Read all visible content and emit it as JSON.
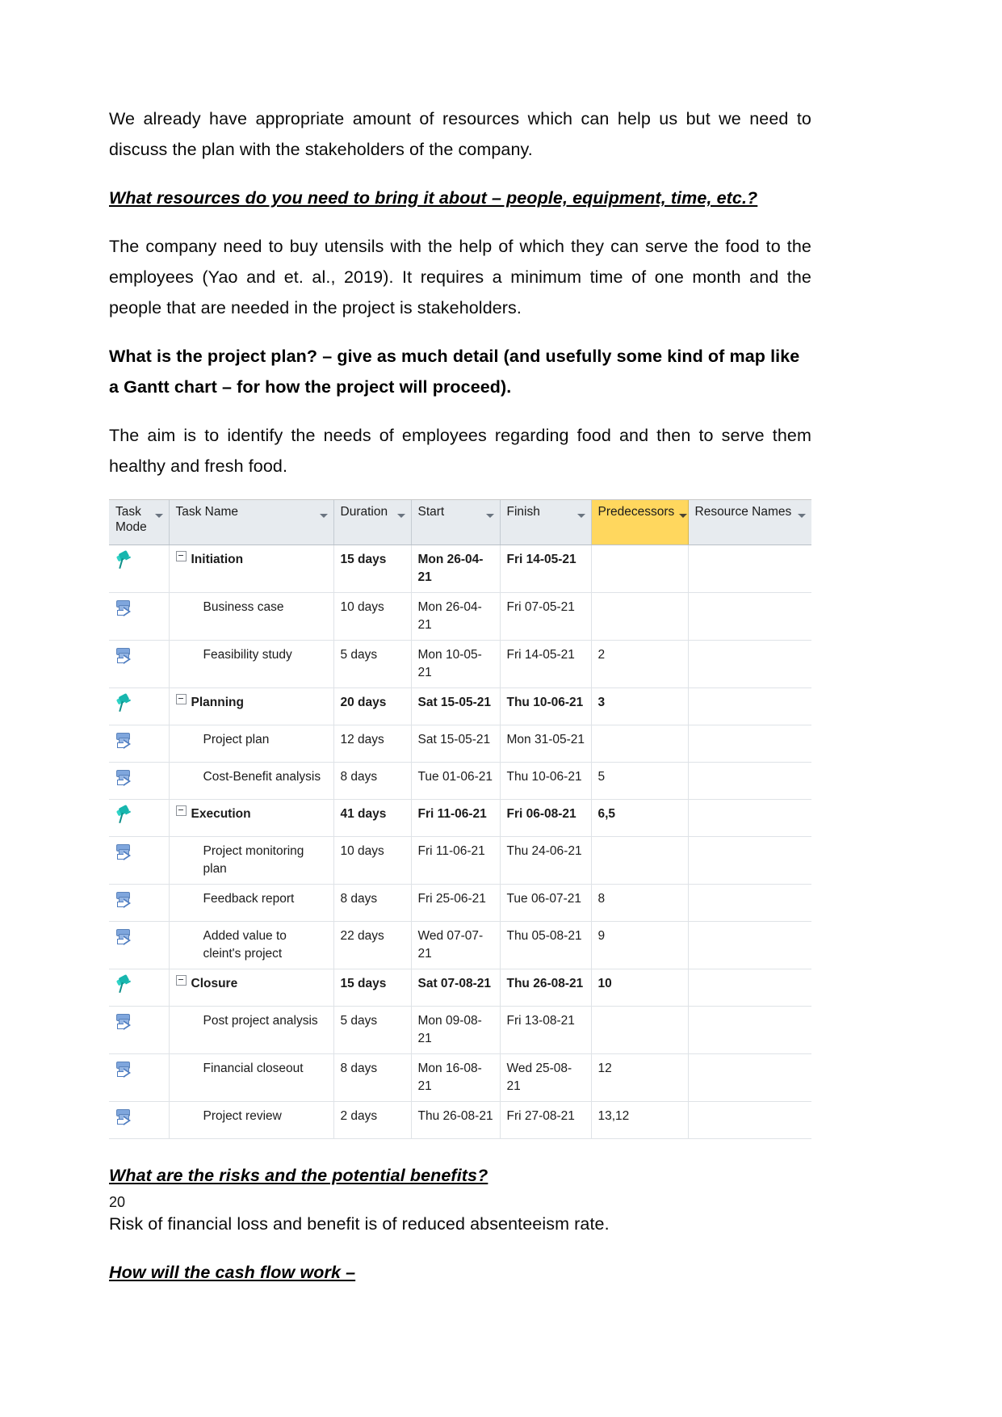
{
  "document": {
    "page_number": "20",
    "paragraphs": {
      "intro": "We already have appropriate amount of resources which can help us but we need to discuss the plan with the stakeholders of the company.",
      "resources_heading": "What resources do you need to bring it about – people, equipment, time, etc.?",
      "resources_answer": "The company need to buy utensils with the help of which they can serve the food to the employees (Yao and et. al., 2019). It requires a minimum time of one month and the people that are needed in the project is stakeholders.",
      "plan_heading": "What is the project plan? – give as much detail (and usefully some kind of map like a Gantt chart – for how the project will proceed).",
      "plan_answer": "The aim is to identify the needs of employees regarding food and then to serve them healthy and fresh food.",
      "risks_heading": "What are the risks and the potential benefits?",
      "risks_answer": "Risk of financial loss and benefit is of reduced absenteeism rate.",
      "cashflow_heading": "How will the cash flow work –"
    }
  },
  "project_table": {
    "highlight_color": "#ffd75e",
    "header_background": "#e7ebef",
    "columns": [
      {
        "label": "Task Mode",
        "key": "mode",
        "has_filter": true,
        "highlighted": false
      },
      {
        "label": "Task Name",
        "key": "name",
        "has_filter": true,
        "highlighted": false
      },
      {
        "label": "Duration",
        "key": "duration",
        "has_filter": true,
        "highlighted": false
      },
      {
        "label": "Start",
        "key": "start",
        "has_filter": true,
        "highlighted": false
      },
      {
        "label": "Finish",
        "key": "finish",
        "has_filter": true,
        "highlighted": false
      },
      {
        "label": "Predecessors",
        "key": "predecessors",
        "has_filter": true,
        "highlighted": true
      },
      {
        "label": "Resource Names",
        "key": "resources",
        "has_filter": true,
        "highlighted": false
      }
    ],
    "rows": [
      {
        "mode_icon": "pin-icon",
        "type": "summary",
        "name": "Initiation",
        "duration": "15 days",
        "start": "Mon 26-04-21",
        "finish": "Fri 14-05-21",
        "predecessors": "",
        "resources": ""
      },
      {
        "mode_icon": "auto-schedule-icon",
        "type": "task",
        "name": "Business case",
        "duration": "10 days",
        "start": "Mon 26-04-21",
        "finish": "Fri 07-05-21",
        "predecessors": "",
        "resources": ""
      },
      {
        "mode_icon": "auto-schedule-icon",
        "type": "task",
        "name": "Feasibility study",
        "duration": "5 days",
        "start": "Mon 10-05-21",
        "finish": "Fri 14-05-21",
        "predecessors": "2",
        "resources": ""
      },
      {
        "mode_icon": "pin-icon",
        "type": "summary",
        "name": "Planning",
        "duration": "20 days",
        "start": "Sat 15-05-21",
        "finish": "Thu 10-06-21",
        "predecessors": "3",
        "resources": ""
      },
      {
        "mode_icon": "auto-schedule-icon",
        "type": "task",
        "name": "Project plan",
        "duration": "12 days",
        "start": "Sat 15-05-21",
        "finish": "Mon 31-05-21",
        "predecessors": "",
        "resources": ""
      },
      {
        "mode_icon": "auto-schedule-icon",
        "type": "task",
        "name": "Cost-Benefit analysis",
        "duration": "8 days",
        "start": "Tue 01-06-21",
        "finish": "Thu 10-06-21",
        "predecessors": "5",
        "resources": ""
      },
      {
        "mode_icon": "pin-icon",
        "type": "summary",
        "name": "Execution",
        "duration": "41 days",
        "start": "Fri 11-06-21",
        "finish": "Fri 06-08-21",
        "predecessors": "6,5",
        "resources": ""
      },
      {
        "mode_icon": "auto-schedule-icon",
        "type": "task",
        "name": "Project monitoring plan",
        "duration": "10 days",
        "start": "Fri 11-06-21",
        "finish": "Thu 24-06-21",
        "predecessors": "",
        "resources": ""
      },
      {
        "mode_icon": "auto-schedule-icon",
        "type": "task",
        "name": "Feedback report",
        "duration": "8 days",
        "start": "Fri 25-06-21",
        "finish": "Tue 06-07-21",
        "predecessors": "8",
        "resources": ""
      },
      {
        "mode_icon": "auto-schedule-icon",
        "type": "task",
        "name": "Added value to cleint's project",
        "duration": "22 days",
        "start": "Wed 07-07-21",
        "finish": "Thu 05-08-21",
        "predecessors": "9",
        "resources": ""
      },
      {
        "mode_icon": "pin-icon",
        "type": "summary",
        "name": "Closure",
        "duration": "15 days",
        "start": "Sat 07-08-21",
        "finish": "Thu 26-08-21",
        "predecessors": "10",
        "resources": ""
      },
      {
        "mode_icon": "auto-schedule-icon",
        "type": "task",
        "name": "Post project analysis",
        "duration": "5 days",
        "start": "Mon 09-08-21",
        "finish": "Fri 13-08-21",
        "predecessors": "",
        "resources": ""
      },
      {
        "mode_icon": "auto-schedule-icon",
        "type": "task",
        "name": "Financial closeout",
        "duration": "8 days",
        "start": "Mon 16-08-21",
        "finish": "Wed 25-08-21",
        "predecessors": "12",
        "resources": ""
      },
      {
        "mode_icon": "auto-schedule-icon",
        "type": "task",
        "name": "Project review",
        "duration": "2 days",
        "start": "Thu 26-08-21",
        "finish": "Fri 27-08-21",
        "predecessors": "13,12",
        "resources": ""
      }
    ]
  }
}
